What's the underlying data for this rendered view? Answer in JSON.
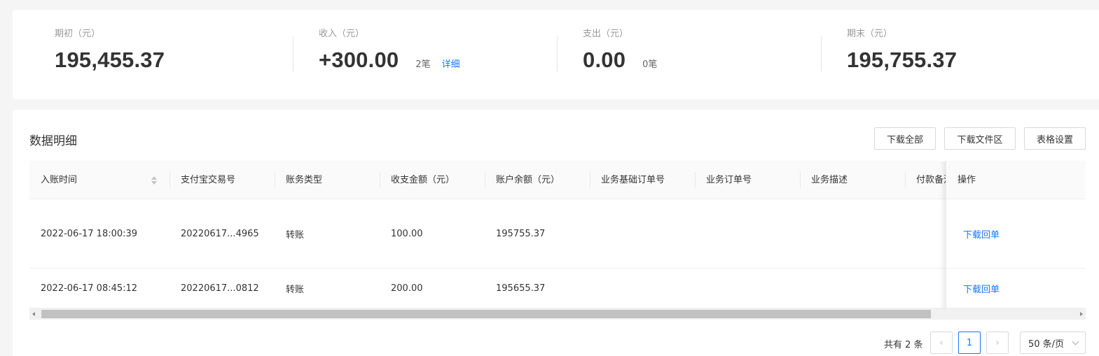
{
  "summary": {
    "opening": {
      "label": "期初（元）",
      "value": "195,455.37"
    },
    "income": {
      "label": "收入（元）",
      "value": "+300.00",
      "count": "2笔",
      "link": "详细"
    },
    "expense": {
      "label": "支出（元）",
      "value": "0.00",
      "count": "0笔"
    },
    "closing": {
      "label": "期末（元）",
      "value": "195,755.37"
    }
  },
  "detail": {
    "title": "数据明细",
    "buttons": {
      "download_all": "下载全部",
      "download_area": "下载文件区",
      "table_settings": "表格设置"
    },
    "columns": [
      "入账时间",
      "支付宝交易号",
      "账务类型",
      "收支金额（元）",
      "账户余额（元）",
      "业务基础订单号",
      "业务订单号",
      "业务描述",
      "付款备注"
    ],
    "action_column": "操作",
    "rows": [
      {
        "time": "2022-06-17 18:00:39",
        "trade_no": "20220617...4965",
        "type": "转账",
        "amount": "100.00",
        "balance": "195755.37",
        "base_order": "",
        "order": "",
        "desc": "",
        "remark": "",
        "action": "下载回单"
      },
      {
        "time": "2022-06-17 08:45:12",
        "trade_no": "20220617...0812",
        "type": "转账",
        "amount": "200.00",
        "balance": "195655.37",
        "base_order": "",
        "order": "",
        "desc": "",
        "remark": "",
        "action": "下载回单"
      }
    ]
  },
  "pagination": {
    "total": "共有 2 条",
    "prev": "‹",
    "current": "1",
    "next": "›",
    "page_size": "50 条/页"
  },
  "colors": {
    "accent": "#1677ff",
    "border": "#d9d9d9",
    "text": "#333333"
  }
}
